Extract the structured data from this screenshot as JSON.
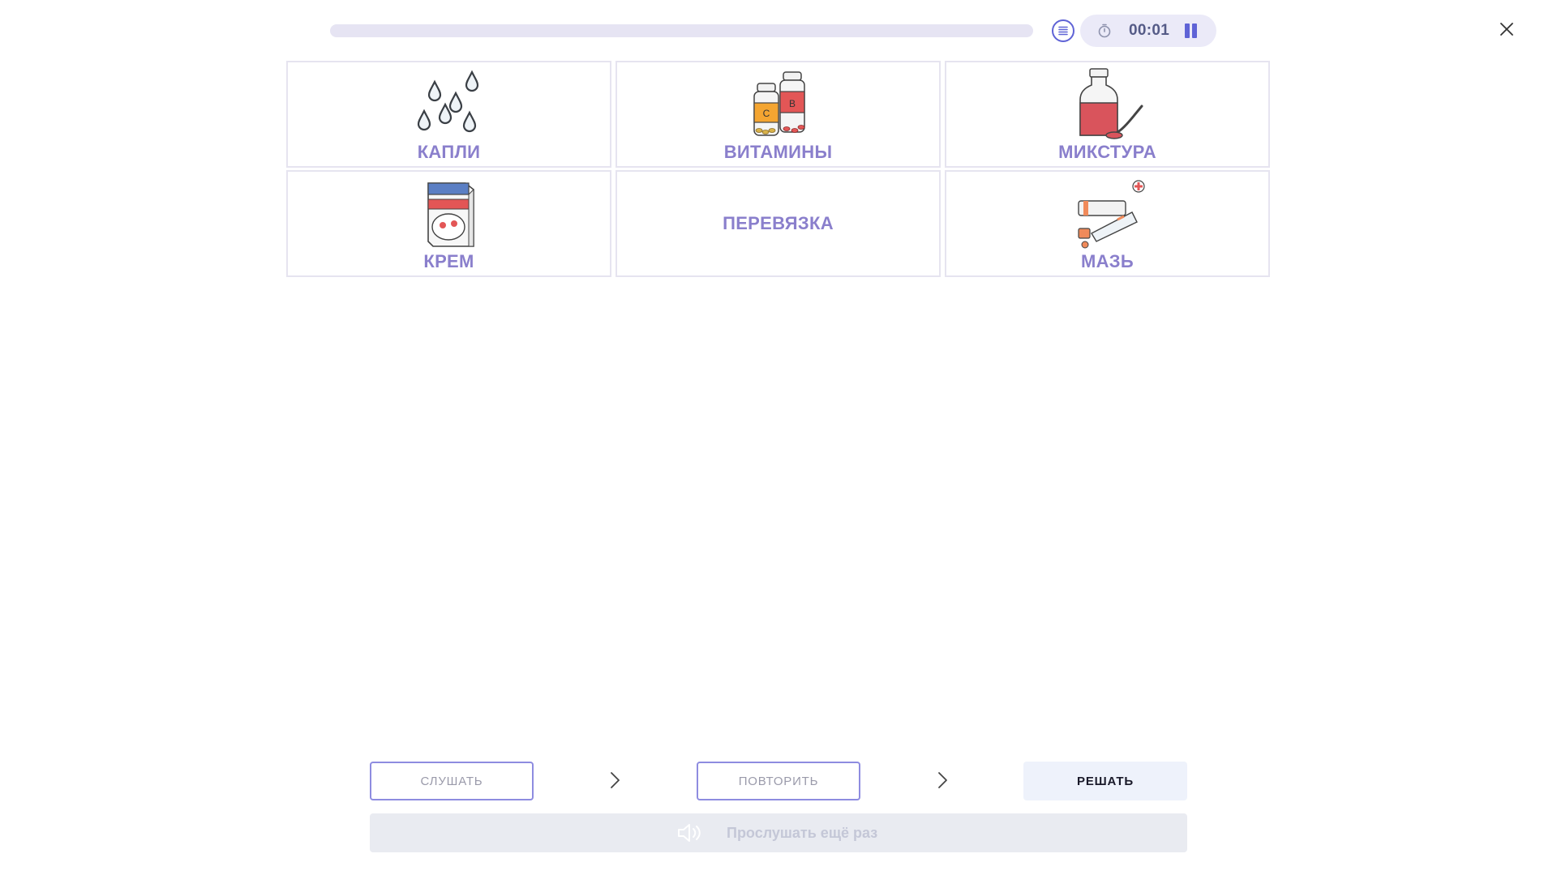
{
  "header": {
    "progress": 0,
    "timer": "00:01",
    "icons": {
      "list": "list-icon",
      "timer": "stopwatch-icon",
      "pause": "pause-icon",
      "close": "close-icon"
    }
  },
  "cards": [
    {
      "label": "КАПЛИ",
      "icon": "drops-icon"
    },
    {
      "label": "ВИТАМИНЫ",
      "icon": "vitamins-icon"
    },
    {
      "label": "МИКСТУРА",
      "icon": "syrup-icon"
    },
    {
      "label": "КРЕМ",
      "icon": "cream-icon"
    },
    {
      "label": "ПЕРЕВЯЗКА",
      "icon": ""
    },
    {
      "label": "МАЗЬ",
      "icon": "ointment-icon"
    }
  ],
  "steps": {
    "listen": "СЛУШАТЬ",
    "repeat": "ПОВТОРИТЬ",
    "solve": "РЕШАТЬ"
  },
  "replay": {
    "label": "Прослушать ещё раз",
    "icon": "speaker-icon"
  },
  "colors": {
    "accent": "#5f63d6",
    "card_label": "#8a7fcc",
    "card_border": "#e6e4f0"
  }
}
